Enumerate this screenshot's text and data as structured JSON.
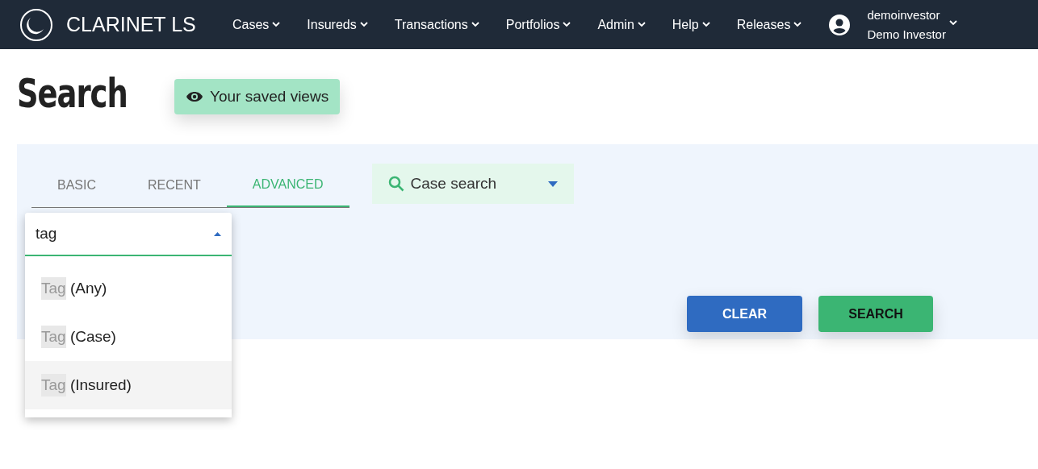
{
  "app": {
    "brand": "CLARINET LS"
  },
  "nav": [
    {
      "label": "Cases"
    },
    {
      "label": "Insureds"
    },
    {
      "label": "Transactions"
    },
    {
      "label": "Portfolios"
    },
    {
      "label": "Admin"
    },
    {
      "label": "Help"
    },
    {
      "label": "Releases"
    }
  ],
  "user": {
    "username": "demoinvestor",
    "name": "Demo Investor"
  },
  "page_title": "Search",
  "saved_views_button": "Your saved views",
  "tabs": [
    {
      "label": "BASIC",
      "selected": false
    },
    {
      "label": "RECENT",
      "selected": false
    },
    {
      "label": "ADVANCED",
      "selected": true
    }
  ],
  "search_type": {
    "value": "Case search"
  },
  "field_picker": {
    "value": "tag",
    "expanded": true,
    "options": [
      {
        "match": "Tag",
        "rest": " (Any)",
        "selected": false
      },
      {
        "match": "Tag",
        "rest": " (Case)",
        "selected": false
      },
      {
        "match": "Tag",
        "rest": " (Insured)",
        "selected": true
      }
    ]
  },
  "buttons": {
    "clear": "CLEAR",
    "search": "SEARCH"
  }
}
